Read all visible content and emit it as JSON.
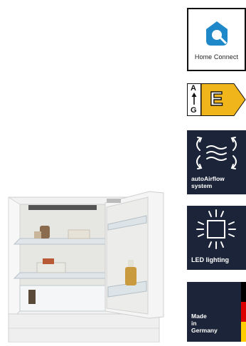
{
  "badges": {
    "home_connect": {
      "label": "Home Connect",
      "icon": "home-connect-icon",
      "color": "#1e88c8"
    },
    "energy": {
      "scale_top": "A",
      "scale_bottom": "G",
      "class": "E",
      "color": "#f1b51c"
    },
    "airflow": {
      "line1": "autoAirflow",
      "line2": "system",
      "icon": "airflow-icon"
    },
    "led": {
      "label": "LED lighting",
      "icon": "led-light-icon"
    },
    "made_in": {
      "line1": "Made",
      "line2": "in",
      "line3": "Germany",
      "flag_colors": [
        "#000000",
        "#dd0000",
        "#ffce00"
      ]
    }
  },
  "colors": {
    "badge_dark": "#1b2438"
  }
}
